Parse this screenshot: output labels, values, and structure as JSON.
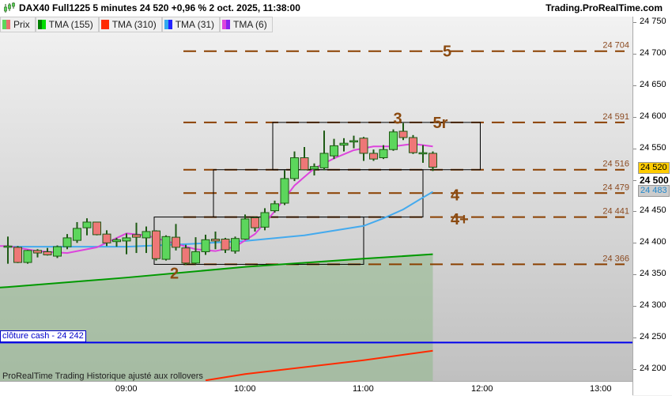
{
  "header": {
    "title": "DAX40 Full1225 5 minutes 24 520 +0,96 % 2 oct. 2025, 11:38:00",
    "site": "Trading.ProRealTime.com",
    "icon": "candlestick-icon"
  },
  "legend": [
    {
      "label": "Prix",
      "colors": [
        "#5cd65c",
        "#e87070"
      ]
    },
    {
      "label": "TMA (155)",
      "colors": [
        "#008000",
        "#00dd00"
      ]
    },
    {
      "label": "TMA (310)",
      "colors": [
        "#ff2a00",
        "#ff2a00"
      ]
    },
    {
      "label": "TMA (31)",
      "colors": [
        "#33aaee",
        "#2222ff"
      ]
    },
    {
      "label": "TMA (6)",
      "colors": [
        "#dd44dd",
        "#8822ee"
      ]
    }
  ],
  "price_axis": {
    "labels": [
      "24 750",
      "24 700",
      "24 650",
      "24 600",
      "24 550",
      "24 500",
      "24 450",
      "24 400",
      "24 350",
      "24 300",
      "24 250",
      "24 200"
    ],
    "values": [
      24750,
      24700,
      24650,
      24600,
      24550,
      24500,
      24450,
      24400,
      24350,
      24300,
      24250,
      24200
    ],
    "bold": "24 500",
    "current": {
      "label": "24 520",
      "value": 24520,
      "color": "#ffcc00"
    },
    "ma_marker": {
      "label": "24 483",
      "value": 24483,
      "color": "#33aaee"
    }
  },
  "time_axis": {
    "labels": [
      "09:00",
      "10:00",
      "11:00",
      "12:00",
      "13:00"
    ],
    "minutes": [
      540,
      600,
      660,
      720,
      780
    ]
  },
  "levels": [
    {
      "value": 24704,
      "label": "24 704"
    },
    {
      "value": 24591,
      "label": "24 591"
    },
    {
      "value": 24516,
      "label": "24 516"
    },
    {
      "value": 24479,
      "label": "24 479"
    },
    {
      "value": 24441,
      "label": "24 441"
    },
    {
      "value": 24366,
      "label": "24 366"
    }
  ],
  "annotations": [
    {
      "text": "5",
      "time": 700,
      "price": 24704
    },
    {
      "text": "5r",
      "time": 695,
      "price": 24591
    },
    {
      "text": "3",
      "time": 675,
      "price": 24598
    },
    {
      "text": "4",
      "time": 704,
      "price": 24476
    },
    {
      "text": "4+",
      "time": 704,
      "price": 24438
    },
    {
      "text": "2",
      "time": 562,
      "price": 24352
    }
  ],
  "boxes": [
    {
      "t0": 554,
      "t1": 660,
      "p0": 24441,
      "p1": 24366
    },
    {
      "t0": 584,
      "t1": 690,
      "p0": 24516,
      "p1": 24441
    },
    {
      "t0": 614,
      "t1": 719,
      "p0": 24591,
      "p1": 24516
    }
  ],
  "cash": {
    "label": "clôture cash -  24 242",
    "value": 24242,
    "color": "#0000ee"
  },
  "footer": "ProRealTime Trading  Historique ajusté aux rollovers",
  "colors": {
    "up": "#5cd65c",
    "down": "#ee7777",
    "wick": "#1e5a14",
    "tma155": "#009900",
    "tma310": "#ff2a00",
    "tma31": "#44aaee",
    "tma6": "#dd44dd",
    "level": "#8b4000"
  },
  "chart_data": {
    "type": "candlestick",
    "start": "08:00",
    "interval_minutes": 5,
    "ohlc": [
      [
        24394,
        24410,
        24367,
        24395
      ],
      [
        24393,
        24395,
        24368,
        24369
      ],
      [
        24369,
        24389,
        24367,
        24388
      ],
      [
        24388,
        24390,
        24377,
        24384
      ],
      [
        24386,
        24392,
        24380,
        24381
      ],
      [
        24379,
        24396,
        24376,
        24394
      ],
      [
        24394,
        24414,
        24390,
        24408
      ],
      [
        24404,
        24433,
        24400,
        24423
      ],
      [
        24424,
        24439,
        24412,
        24433
      ],
      [
        24433,
        24433,
        24412,
        24413
      ],
      [
        24414,
        24420,
        24395,
        24400
      ],
      [
        24402,
        24408,
        24394,
        24405
      ],
      [
        24403,
        24415,
        24382,
        24408
      ],
      [
        24413,
        24432,
        24384,
        24409
      ],
      [
        24408,
        24426,
        24384,
        24418
      ],
      [
        24419,
        24420,
        24372,
        24375
      ],
      [
        24374,
        24412,
        24372,
        24410
      ],
      [
        24409,
        24430,
        24388,
        24393
      ],
      [
        24392,
        24397,
        24365,
        24368
      ],
      [
        24368,
        24409,
        24366,
        24386
      ],
      [
        24386,
        24413,
        24381,
        24405
      ],
      [
        24406,
        24418,
        24390,
        24403
      ],
      [
        24406,
        24408,
        24384,
        24389
      ],
      [
        24387,
        24410,
        24383,
        24407
      ],
      [
        24406,
        24445,
        24405,
        24438
      ],
      [
        24440,
        24441,
        24418,
        24424
      ],
      [
        24425,
        24455,
        24420,
        24448
      ],
      [
        24451,
        24467,
        24448,
        24462
      ],
      [
        24463,
        24515,
        24460,
        24502
      ],
      [
        24502,
        24545,
        24498,
        24535
      ],
      [
        24535,
        24552,
        24515,
        24516
      ],
      [
        24517,
        24526,
        24507,
        24521
      ],
      [
        24519,
        24578,
        24515,
        24542
      ],
      [
        24538,
        24565,
        24533,
        24554
      ],
      [
        24555,
        24566,
        24545,
        24558
      ],
      [
        24560,
        24570,
        24550,
        24562
      ],
      [
        24566,
        24568,
        24530,
        24542
      ],
      [
        24542,
        24548,
        24530,
        24533
      ],
      [
        24535,
        24555,
        24533,
        24548
      ],
      [
        24548,
        24580,
        24546,
        24576
      ],
      [
        24577,
        24590,
        24563,
        24567
      ],
      [
        24567,
        24571,
        24541,
        24543
      ],
      [
        24543,
        24555,
        24527,
        24543
      ],
      [
        24542,
        24545,
        24514,
        24520
      ]
    ],
    "tma6": [
      [
        480,
        24395
      ],
      [
        495,
        24387
      ],
      [
        510,
        24384
      ],
      [
        525,
        24393
      ],
      [
        540,
        24415
      ],
      [
        550,
        24412
      ],
      [
        560,
        24403
      ],
      [
        575,
        24390
      ],
      [
        585,
        24387
      ],
      [
        595,
        24394
      ],
      [
        605,
        24414
      ],
      [
        615,
        24450
      ],
      [
        625,
        24491
      ],
      [
        635,
        24518
      ],
      [
        645,
        24534
      ],
      [
        655,
        24547
      ],
      [
        665,
        24553
      ],
      [
        675,
        24553
      ],
      [
        685,
        24557
      ],
      [
        695,
        24553
      ]
    ],
    "tma31": [
      [
        480,
        24394
      ],
      [
        540,
        24394
      ],
      [
        570,
        24398
      ],
      [
        600,
        24403
      ],
      [
        630,
        24412
      ],
      [
        660,
        24427
      ],
      [
        670,
        24439
      ],
      [
        680,
        24453
      ],
      [
        690,
        24472
      ],
      [
        695,
        24481
      ]
    ],
    "tma155": [
      [
        480,
        24330
      ],
      [
        540,
        24345
      ],
      [
        600,
        24362
      ],
      [
        660,
        24375
      ],
      [
        695,
        24382
      ]
    ],
    "tma310": [
      [
        580,
        24182
      ],
      [
        600,
        24192
      ],
      [
        660,
        24214
      ],
      [
        695,
        24229
      ]
    ],
    "ylim": [
      24180,
      24760
    ]
  }
}
